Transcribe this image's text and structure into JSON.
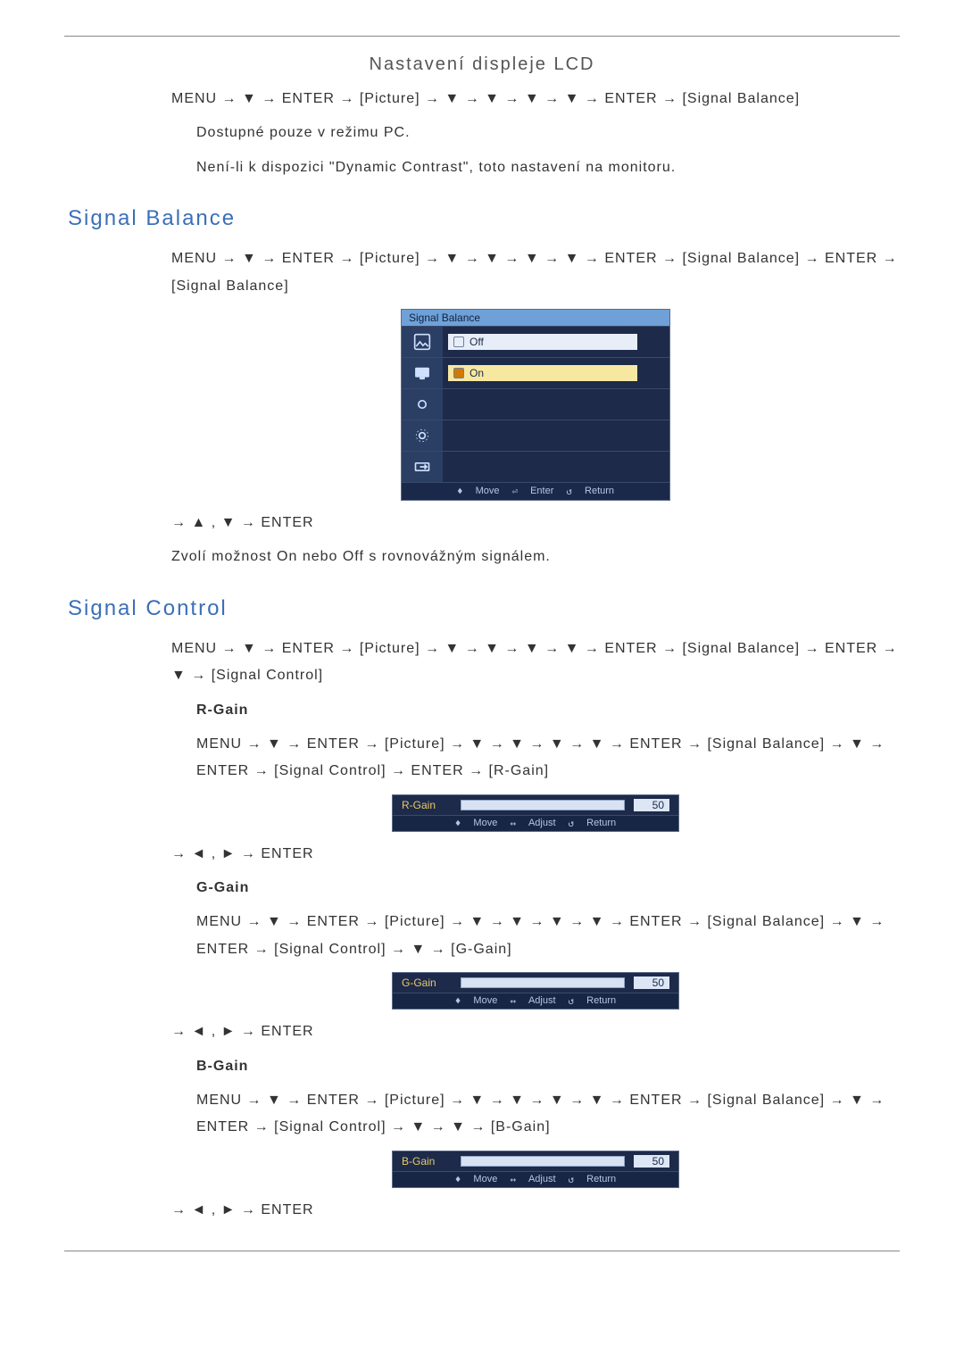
{
  "header": {
    "title": "Nastavení displeje LCD"
  },
  "avail_path": {
    "line1": "MENU → ▼ → ENTER → [Picture] → ▼ → ▼ → ▼ → ▼ → ENTER → [Signal Balance]",
    "availability": "Dostupné pouze v režimu PC.",
    "purpose": "Není-li k dispozici \"Dynamic Contrast\", toto nastavení na monitoru."
  },
  "signal_balance": {
    "title": "Signal Balance",
    "path": "MENU → ▼ → ENTER → [Picture] → ▼ → ▼ → ▼ → ▼ → ENTER → [Signal Balance] → ENTER → [Signal Balance]",
    "menu_title": "Signal Balance",
    "options": {
      "off": "Off",
      "on": "On"
    },
    "footer": {
      "move": "Move",
      "enter": "Enter",
      "return": "Return"
    },
    "nav": "→ ▲ , ▼ → ENTER",
    "note": "Zvolí možnost On nebo Off s rovnovážným signálem."
  },
  "signal_control": {
    "title": "Signal Control",
    "path": "MENU → ▼ → ENTER → [Picture] → ▼ → ▼ → ▼ → ▼ → ENTER → [Signal Balance] → ENTER → ▼ → [Signal Control]",
    "r": {
      "heading": "R-Gain",
      "path": "MENU → ▼ → ENTER → [Picture] → ▼ → ▼ → ▼ → ▼ → ENTER → [Signal Balance] → ▼ → ENTER → [Signal Control] → ENTER → [R-Gain]",
      "slider": {
        "label": "R-Gain",
        "value": "50",
        "fill_pct": 50,
        "footer": {
          "move": "Move",
          "adjust": "Adjust",
          "return": "Return"
        }
      },
      "nav": "→ ◄ , ► → ENTER"
    },
    "g": {
      "heading": "G-Gain",
      "path": "MENU → ▼ → ENTER → [Picture] → ▼ → ▼ → ▼ → ▼ → ENTER → [Signal Balance] → ▼ → ENTER → [Signal Control] → ▼ → [G-Gain]",
      "slider": {
        "label": "G-Gain",
        "value": "50",
        "fill_pct": 50,
        "footer": {
          "move": "Move",
          "adjust": "Adjust",
          "return": "Return"
        }
      },
      "nav": "→ ◄ , ► → ENTER"
    },
    "b": {
      "heading": "B-Gain",
      "path": "MENU → ▼ → ENTER → [Picture] → ▼ → ▼ → ▼ → ▼ → ENTER → [Signal Balance] → ▼ → ENTER → [Signal Control] → ▼ → ▼ → [B-Gain]",
      "slider": {
        "label": "B-Gain",
        "value": "50",
        "fill_pct": 50,
        "footer": {
          "move": "Move",
          "adjust": "Adjust",
          "return": "Return"
        }
      },
      "nav": "→ ◄ , ► → ENTER"
    }
  }
}
